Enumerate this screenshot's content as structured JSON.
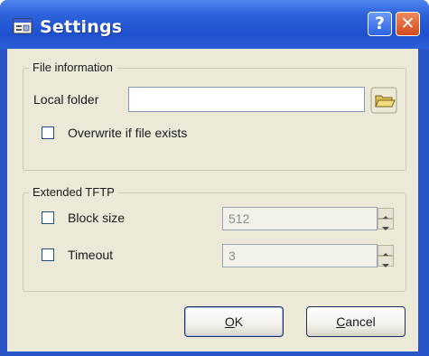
{
  "window": {
    "title": "Settings",
    "help_label": "?",
    "close_label": "✕",
    "title_icon": "settings-app-icon"
  },
  "file_information": {
    "group_title": "File information",
    "local_folder_label": "Local folder",
    "local_folder_value": "",
    "browse_icon": "folder-icon",
    "overwrite_label": "Overwrite if file exists",
    "overwrite_checked": false
  },
  "extended_tftp": {
    "group_title": "Extended TFTP",
    "block_size_label": "Block size",
    "block_size_checked": false,
    "block_size_value": "512",
    "timeout_label": "Timeout",
    "timeout_checked": false,
    "timeout_value": "3"
  },
  "buttons": {
    "ok_mnemonic": "O",
    "ok_rest": "K",
    "cancel_mnemonic": "C",
    "cancel_rest": "ancel"
  },
  "colors": {
    "titlebar": "#2e63db",
    "dialog_face": "#ece9d8",
    "close_button": "#d24a1e"
  }
}
